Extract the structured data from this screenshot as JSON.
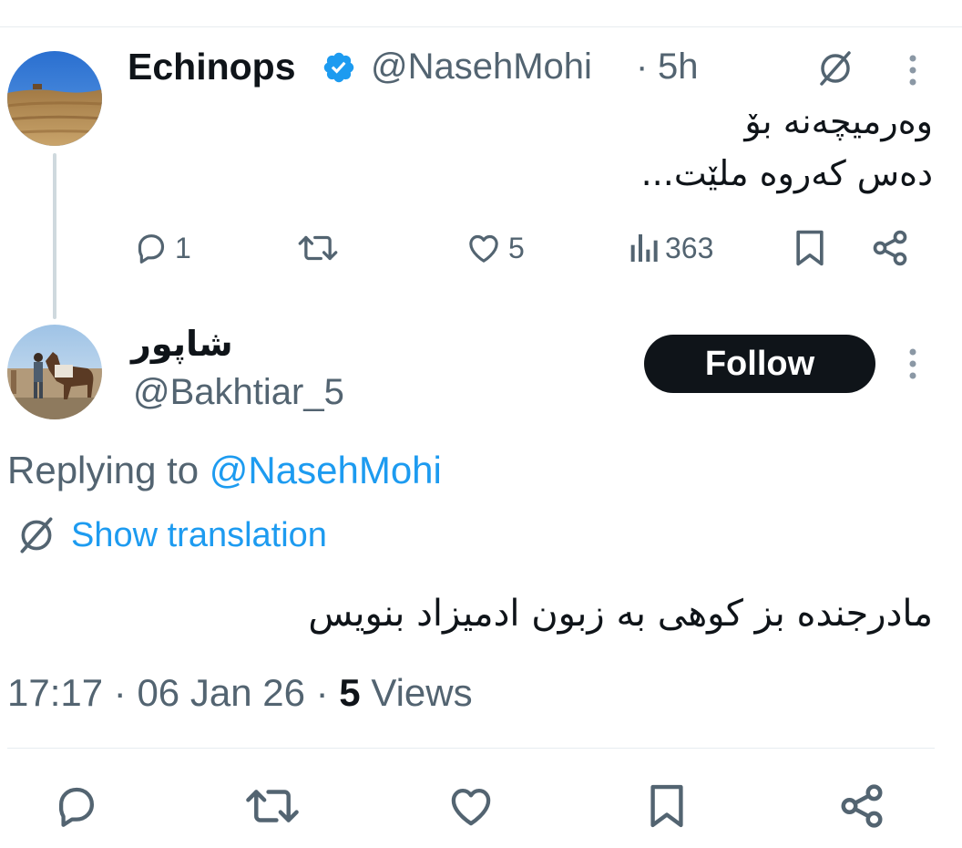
{
  "parent_tweet": {
    "author_name": "Echinops",
    "handle": "@NasehMohi",
    "separator": "·",
    "time": "5h",
    "text_lines": [
      "وەرمیچەنە بۆ",
      "دەس کەروە ملێت..."
    ],
    "stats": {
      "replies": "1",
      "likes": "5",
      "views": "363"
    }
  },
  "reply_tweet": {
    "author_name": "شاپور",
    "handle": "@Bakhtiar_5",
    "follow_label": "Follow",
    "replying_prefix": "Replying to",
    "replying_handle": "@NasehMohi",
    "show_translation_label": "Show translation",
    "text": "مادرجنده بز کوهی به زبون ادمیزاد بنویس",
    "time": "17:17",
    "date": "06 Jan 26",
    "views_count": "5",
    "views_label": "Views",
    "dot": "·"
  },
  "icons": {
    "verified": "verified-badge-icon",
    "translate": "translate-icon",
    "more": "more-vertical-icon",
    "reply": "reply-icon",
    "retweet": "retweet-icon",
    "like": "heart-icon",
    "views": "views-chart-icon",
    "bookmark": "bookmark-icon",
    "share": "share-icon"
  },
  "colors": {
    "accent": "#1d9bf0",
    "text_primary": "#0f1419",
    "text_secondary": "#536471",
    "divider": "#e7ecf0",
    "thread_line": "#cfd9de",
    "follow_bg": "#0f1419"
  }
}
